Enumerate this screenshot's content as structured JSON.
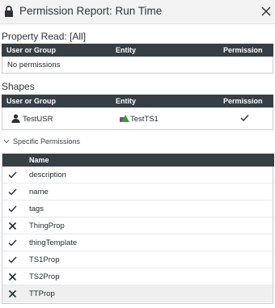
{
  "window": {
    "title": "Permission Report: Run Time",
    "title_icon": "lock-icon",
    "close_icon": "close-icon"
  },
  "property_read": {
    "label": "Property Read: [All]",
    "columns": [
      "User or Group",
      "Entity",
      "Permission"
    ],
    "empty_text": "No permissions"
  },
  "shapes": {
    "label": "Shapes",
    "columns": [
      "User or Group",
      "Entity",
      "Permission"
    ],
    "rows": [
      {
        "user": "TestUSR",
        "user_icon": "user-icon",
        "entity": "TestTS1",
        "entity_icon": "thing-shape-icon",
        "permission": "check-icon"
      }
    ]
  },
  "specific_permissions": {
    "label": "Specific Permissions",
    "expanded": true,
    "column": "Name",
    "rows": [
      {
        "name": "description",
        "allowed": true
      },
      {
        "name": "name",
        "allowed": true
      },
      {
        "name": "tags",
        "allowed": true
      },
      {
        "name": "ThingProp",
        "allowed": false
      },
      {
        "name": "thingTemplate",
        "allowed": true
      },
      {
        "name": "TS1Prop",
        "allowed": true
      },
      {
        "name": "TS2Prop",
        "allowed": false
      },
      {
        "name": "TTProp",
        "allowed": false
      }
    ]
  },
  "colors": {
    "header_bg": "#363f45",
    "title_bg": "#f3f3f3",
    "shape_green": "#3f9a3a",
    "shape_gray": "#5a6268"
  }
}
